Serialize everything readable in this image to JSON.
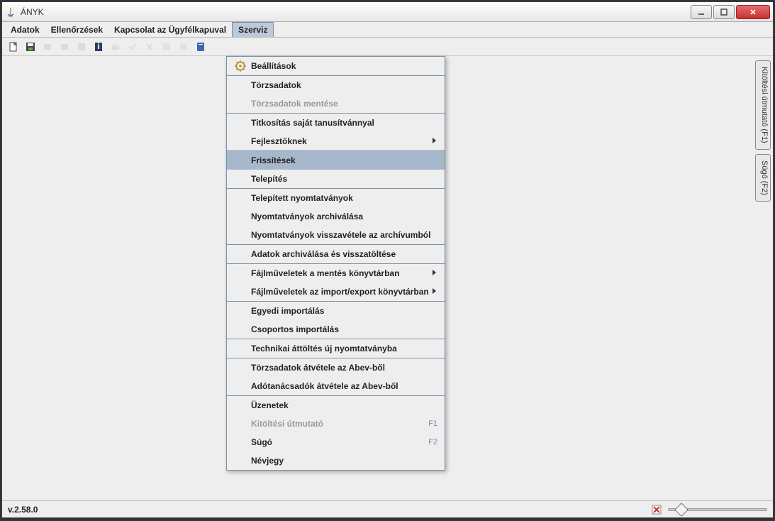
{
  "window": {
    "title": "ÁNYK"
  },
  "menubar": {
    "items": [
      {
        "label": "Adatok"
      },
      {
        "label": "Ellenőrzések"
      },
      {
        "label": "Kapcsolat az Ügyfélkapuval"
      },
      {
        "label": "Szerviz",
        "active": true
      }
    ]
  },
  "dropdown": {
    "groups": [
      [
        {
          "label": "Beállítások",
          "icon": "gear"
        }
      ],
      [
        {
          "label": "Törzsadatok"
        },
        {
          "label": "Törzsadatok mentése",
          "disabled": true
        }
      ],
      [
        {
          "label": "Titkosítás saját tanusítvánnyal"
        },
        {
          "label": "Fejlesztőknek",
          "submenu": true
        }
      ],
      [
        {
          "label": "Frissítések",
          "highlight": true
        },
        {
          "label": "Telepítés"
        }
      ],
      [
        {
          "label": "Telepített nyomtatványok"
        },
        {
          "label": "Nyomtatványok archiválása"
        },
        {
          "label": "Nyomtatványok visszavétele az archívumból"
        }
      ],
      [
        {
          "label": "Adatok archiválása és visszatöltése"
        }
      ],
      [
        {
          "label": "Fájlműveletek a mentés könyvtárban",
          "submenu": true
        },
        {
          "label": "Fájlműveletek az import/export könyvtárban",
          "submenu": true
        }
      ],
      [
        {
          "label": "Egyedi importálás"
        },
        {
          "label": "Csoportos importálás"
        }
      ],
      [
        {
          "label": "Technikai áttöltés új nyomtatványba"
        }
      ],
      [
        {
          "label": "Törzsadatok átvétele az Abev-ből"
        },
        {
          "label": "Adótanácsadók átvétele az Abev-ből"
        }
      ],
      [
        {
          "label": "Üzenetek"
        },
        {
          "label": "Kitöltési útmutató",
          "shortcut": "F1",
          "disabled": true
        },
        {
          "label": "Súgó",
          "shortcut": "F2"
        },
        {
          "label": "Névjegy"
        }
      ]
    ]
  },
  "side_tabs": {
    "items": [
      {
        "label": "Kitöltési útmutató (F1)"
      },
      {
        "label": "Súgó (F2)"
      }
    ]
  },
  "statusbar": {
    "version": "v.2.58.0"
  }
}
